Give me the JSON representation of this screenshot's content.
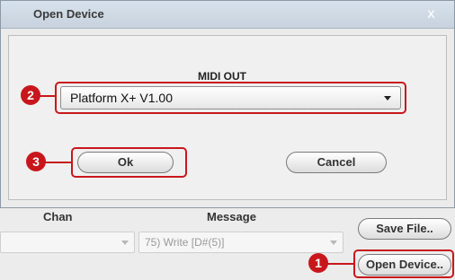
{
  "dialog": {
    "title": "Open Device",
    "close_glyph": "x",
    "midi_out_label": "MIDI OUT",
    "midi_out_selected": "Platform X+ V1.00",
    "ok_label": "Ok",
    "cancel_label": "Cancel"
  },
  "background": {
    "chan_label": "Chan",
    "message_label": "Message",
    "message_value": "75) Write [D#(5)]",
    "save_file_label": "Save File..",
    "open_device_label": "Open Device.."
  },
  "callouts": {
    "one": "1",
    "two": "2",
    "three": "3",
    "color": "#c8171c"
  },
  "icons": [
    "close-icon",
    "chevron-down-icon"
  ]
}
